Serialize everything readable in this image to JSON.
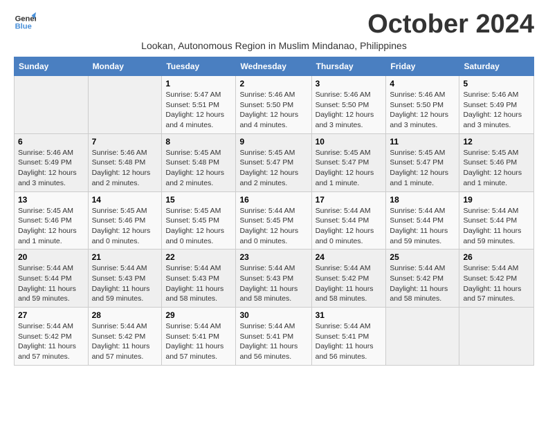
{
  "logo": {
    "line1": "General",
    "line2": "Blue"
  },
  "title": "October 2024",
  "subtitle": "Lookan, Autonomous Region in Muslim Mindanao, Philippines",
  "weekdays": [
    "Sunday",
    "Monday",
    "Tuesday",
    "Wednesday",
    "Thursday",
    "Friday",
    "Saturday"
  ],
  "weeks": [
    [
      {
        "day": "",
        "info": ""
      },
      {
        "day": "",
        "info": ""
      },
      {
        "day": "1",
        "info": "Sunrise: 5:47 AM\nSunset: 5:51 PM\nDaylight: 12 hours and 4 minutes."
      },
      {
        "day": "2",
        "info": "Sunrise: 5:46 AM\nSunset: 5:50 PM\nDaylight: 12 hours and 4 minutes."
      },
      {
        "day": "3",
        "info": "Sunrise: 5:46 AM\nSunset: 5:50 PM\nDaylight: 12 hours and 3 minutes."
      },
      {
        "day": "4",
        "info": "Sunrise: 5:46 AM\nSunset: 5:50 PM\nDaylight: 12 hours and 3 minutes."
      },
      {
        "day": "5",
        "info": "Sunrise: 5:46 AM\nSunset: 5:49 PM\nDaylight: 12 hours and 3 minutes."
      }
    ],
    [
      {
        "day": "6",
        "info": "Sunrise: 5:46 AM\nSunset: 5:49 PM\nDaylight: 12 hours and 3 minutes."
      },
      {
        "day": "7",
        "info": "Sunrise: 5:46 AM\nSunset: 5:48 PM\nDaylight: 12 hours and 2 minutes."
      },
      {
        "day": "8",
        "info": "Sunrise: 5:45 AM\nSunset: 5:48 PM\nDaylight: 12 hours and 2 minutes."
      },
      {
        "day": "9",
        "info": "Sunrise: 5:45 AM\nSunset: 5:47 PM\nDaylight: 12 hours and 2 minutes."
      },
      {
        "day": "10",
        "info": "Sunrise: 5:45 AM\nSunset: 5:47 PM\nDaylight: 12 hours and 1 minute."
      },
      {
        "day": "11",
        "info": "Sunrise: 5:45 AM\nSunset: 5:47 PM\nDaylight: 12 hours and 1 minute."
      },
      {
        "day": "12",
        "info": "Sunrise: 5:45 AM\nSunset: 5:46 PM\nDaylight: 12 hours and 1 minute."
      }
    ],
    [
      {
        "day": "13",
        "info": "Sunrise: 5:45 AM\nSunset: 5:46 PM\nDaylight: 12 hours and 1 minute."
      },
      {
        "day": "14",
        "info": "Sunrise: 5:45 AM\nSunset: 5:46 PM\nDaylight: 12 hours and 0 minutes."
      },
      {
        "day": "15",
        "info": "Sunrise: 5:45 AM\nSunset: 5:45 PM\nDaylight: 12 hours and 0 minutes."
      },
      {
        "day": "16",
        "info": "Sunrise: 5:44 AM\nSunset: 5:45 PM\nDaylight: 12 hours and 0 minutes."
      },
      {
        "day": "17",
        "info": "Sunrise: 5:44 AM\nSunset: 5:44 PM\nDaylight: 12 hours and 0 minutes."
      },
      {
        "day": "18",
        "info": "Sunrise: 5:44 AM\nSunset: 5:44 PM\nDaylight: 11 hours and 59 minutes."
      },
      {
        "day": "19",
        "info": "Sunrise: 5:44 AM\nSunset: 5:44 PM\nDaylight: 11 hours and 59 minutes."
      }
    ],
    [
      {
        "day": "20",
        "info": "Sunrise: 5:44 AM\nSunset: 5:44 PM\nDaylight: 11 hours and 59 minutes."
      },
      {
        "day": "21",
        "info": "Sunrise: 5:44 AM\nSunset: 5:43 PM\nDaylight: 11 hours and 59 minutes."
      },
      {
        "day": "22",
        "info": "Sunrise: 5:44 AM\nSunset: 5:43 PM\nDaylight: 11 hours and 58 minutes."
      },
      {
        "day": "23",
        "info": "Sunrise: 5:44 AM\nSunset: 5:43 PM\nDaylight: 11 hours and 58 minutes."
      },
      {
        "day": "24",
        "info": "Sunrise: 5:44 AM\nSunset: 5:42 PM\nDaylight: 11 hours and 58 minutes."
      },
      {
        "day": "25",
        "info": "Sunrise: 5:44 AM\nSunset: 5:42 PM\nDaylight: 11 hours and 58 minutes."
      },
      {
        "day": "26",
        "info": "Sunrise: 5:44 AM\nSunset: 5:42 PM\nDaylight: 11 hours and 57 minutes."
      }
    ],
    [
      {
        "day": "27",
        "info": "Sunrise: 5:44 AM\nSunset: 5:42 PM\nDaylight: 11 hours and 57 minutes."
      },
      {
        "day": "28",
        "info": "Sunrise: 5:44 AM\nSunset: 5:42 PM\nDaylight: 11 hours and 57 minutes."
      },
      {
        "day": "29",
        "info": "Sunrise: 5:44 AM\nSunset: 5:41 PM\nDaylight: 11 hours and 57 minutes."
      },
      {
        "day": "30",
        "info": "Sunrise: 5:44 AM\nSunset: 5:41 PM\nDaylight: 11 hours and 56 minutes."
      },
      {
        "day": "31",
        "info": "Sunrise: 5:44 AM\nSunset: 5:41 PM\nDaylight: 11 hours and 56 minutes."
      },
      {
        "day": "",
        "info": ""
      },
      {
        "day": "",
        "info": ""
      }
    ]
  ]
}
